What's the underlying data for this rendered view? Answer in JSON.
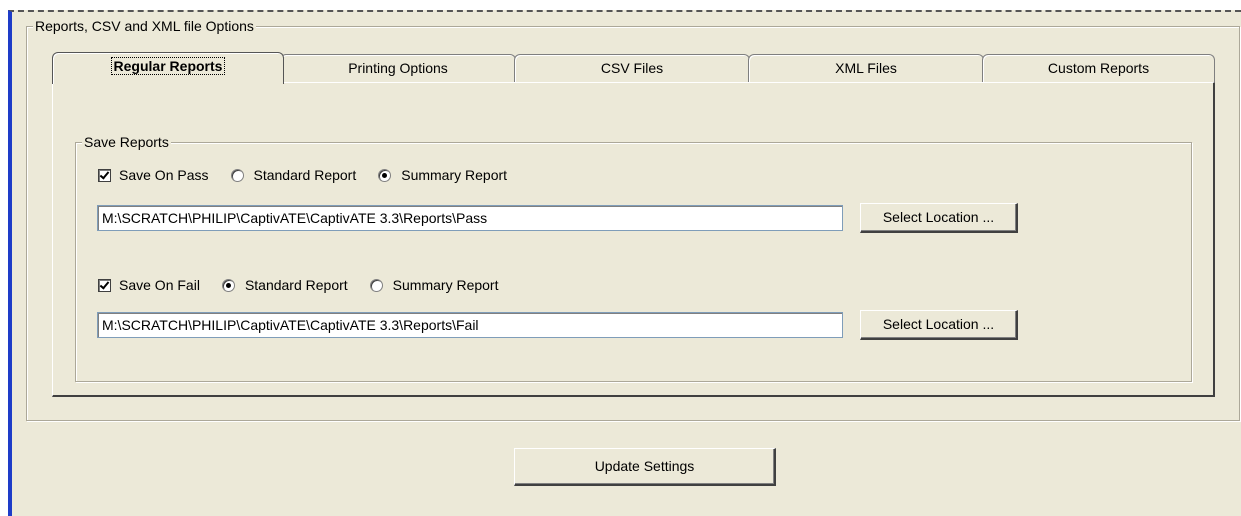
{
  "outer_group": {
    "title": "Reports, CSV and XML file Options"
  },
  "tabs": [
    {
      "label": "Regular Reports",
      "active": true
    },
    {
      "label": "Printing Options",
      "active": false
    },
    {
      "label": "CSV Files",
      "active": false
    },
    {
      "label": "XML Files",
      "active": false
    },
    {
      "label": "Custom Reports",
      "active": false
    }
  ],
  "save_reports": {
    "title": "Save Reports",
    "pass": {
      "checkbox_label": "Save On Pass",
      "checked": true,
      "standard_label": "Standard Report",
      "summary_label": "Summary Report",
      "selected": "summary",
      "path": "M:\\SCRATCH\\PHILIP\\CaptivATE\\CaptivATE 3.3\\Reports\\Pass",
      "select_button": "Select Location ..."
    },
    "fail": {
      "checkbox_label": "Save On Fail",
      "checked": true,
      "standard_label": "Standard Report",
      "summary_label": "Summary Report",
      "selected": "standard",
      "path": "M:\\SCRATCH\\PHILIP\\CaptivATE\\CaptivATE 3.3\\Reports\\Fail",
      "select_button": "Select Location ..."
    }
  },
  "update_button": "Update Settings",
  "colors": {
    "panel": "#ece9d8",
    "left_accent": "#1e3cc8"
  }
}
